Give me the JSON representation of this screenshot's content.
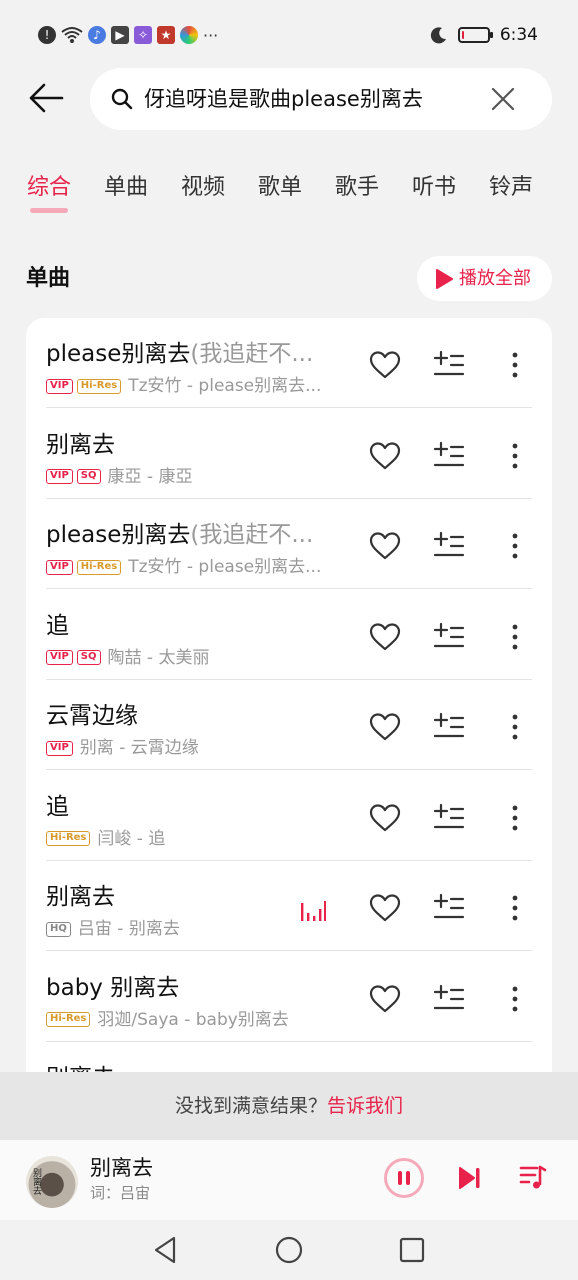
{
  "status_bar": {
    "time": "6:34",
    "icons": [
      "alert-icon",
      "wifi-icon",
      "music-app-icon",
      "video-icon",
      "app-icon",
      "app-icon",
      "app-icon",
      "more-dots"
    ],
    "battery_level": 0.1
  },
  "header": {
    "back_icon": "arrow-left-icon",
    "search_value": "伢追呀追是歌曲please别离去",
    "clear_icon": "close-icon"
  },
  "tabs": [
    {
      "label": "综合",
      "active": true
    },
    {
      "label": "单曲",
      "active": false
    },
    {
      "label": "视频",
      "active": false
    },
    {
      "label": "歌单",
      "active": false
    },
    {
      "label": "歌手",
      "active": false
    },
    {
      "label": "听书",
      "active": false
    },
    {
      "label": "铃声",
      "active": false
    }
  ],
  "section": {
    "title": "单曲",
    "play_all_label": "播放全部"
  },
  "songs": [
    {
      "title": "please别离去",
      "title_dim": "(我追赶不...",
      "badges": [
        "VIP",
        "Hi-Res"
      ],
      "artist": "Tz安竹 - please别离去..."
    },
    {
      "title": "别离去",
      "title_dim": "",
      "badges": [
        "VIP",
        "SQ"
      ],
      "artist": "康亞 - 康亞"
    },
    {
      "title": "please别离去",
      "title_dim": "(我追赶不...",
      "badges": [
        "VIP",
        "Hi-Res"
      ],
      "artist": "Tz安竹 - please别离去..."
    },
    {
      "title": "追",
      "title_dim": "",
      "badges": [
        "VIP",
        "SQ"
      ],
      "artist": "陶喆 - 太美丽"
    },
    {
      "title": "云霄边缘",
      "title_dim": "",
      "badges": [
        "VIP"
      ],
      "artist": "别离 - 云霄边缘"
    },
    {
      "title": "追",
      "title_dim": "",
      "badges": [
        "Hi-Res"
      ],
      "artist": "闫峻 - 追"
    },
    {
      "title": "别离去",
      "title_dim": "",
      "badges": [
        "HQ"
      ],
      "artist": "吕宙 - 别离去",
      "playing": true
    },
    {
      "title": "baby 别离去",
      "title_dim": "",
      "badges": [
        "Hi-Res"
      ],
      "artist": "羽迦/Saya - baby别离去"
    },
    {
      "title": "别离去",
      "title_dim": "",
      "badges": [],
      "artist": ""
    }
  ],
  "feedback": {
    "text": "没找到满意结果？",
    "link": "告诉我们"
  },
  "now_playing": {
    "title": "别离去",
    "subtitle": "词：吕宙",
    "cover_text": "别离去"
  },
  "colors": {
    "accent": "#e8224a",
    "hires": "#d89a2a",
    "background": "#f2f2f2"
  }
}
